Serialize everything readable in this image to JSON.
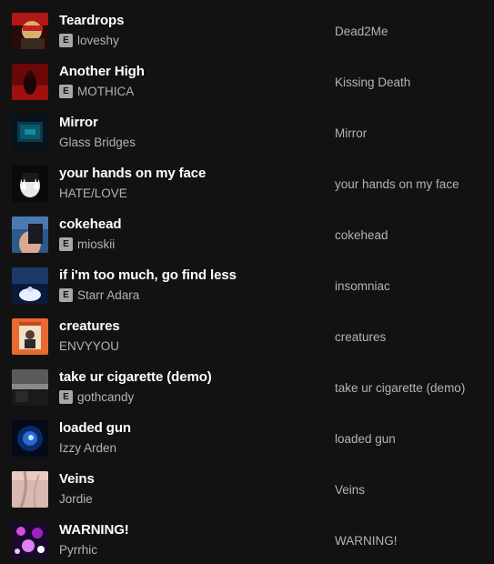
{
  "tracks": [
    {
      "title": "Teardrops",
      "artist": "loveshy",
      "explicit": "E",
      "album": "Dead2Me",
      "cover_icon": "teardrops-cover"
    },
    {
      "title": "Another High",
      "artist": "MOTHICA",
      "explicit": "E",
      "album": "Kissing Death",
      "cover_icon": "another-high-cover"
    },
    {
      "title": "Mirror",
      "artist": "Glass Bridges",
      "explicit": "",
      "album": "Mirror",
      "cover_icon": "mirror-cover"
    },
    {
      "title": "your hands on my face",
      "artist": "HATE/LOVE",
      "explicit": "",
      "album": "your hands on my face",
      "cover_icon": "hands-cover"
    },
    {
      "title": "cokehead",
      "artist": "mioskii",
      "explicit": "E",
      "album": "cokehead",
      "cover_icon": "cokehead-cover"
    },
    {
      "title": "if i'm too much, go find less",
      "artist": "Starr Adara",
      "explicit": "E",
      "album": "insomniac",
      "cover_icon": "insomniac-cover"
    },
    {
      "title": "creatures",
      "artist": "ENVYYOU",
      "explicit": "",
      "album": "creatures",
      "cover_icon": "creatures-cover"
    },
    {
      "title": "take ur cigarette (demo)",
      "artist": "gothcandy",
      "explicit": "E",
      "album": "take ur cigarette (demo)",
      "cover_icon": "cigarette-cover"
    },
    {
      "title": "loaded gun",
      "artist": "Izzy Arden",
      "explicit": "",
      "album": "loaded gun",
      "cover_icon": "loaded-gun-cover"
    },
    {
      "title": "Veins",
      "artist": "Jordie",
      "explicit": "",
      "album": "Veins",
      "cover_icon": "veins-cover"
    },
    {
      "title": "WARNING!",
      "artist": "Pyrrhic",
      "explicit": "",
      "album": "WARNING!",
      "cover_icon": "warning-cover"
    }
  ],
  "colors": {
    "background": "#121212",
    "title": "#ffffff",
    "secondary": "#b3b3b3",
    "explicit_badge": "#a7a7a7"
  }
}
